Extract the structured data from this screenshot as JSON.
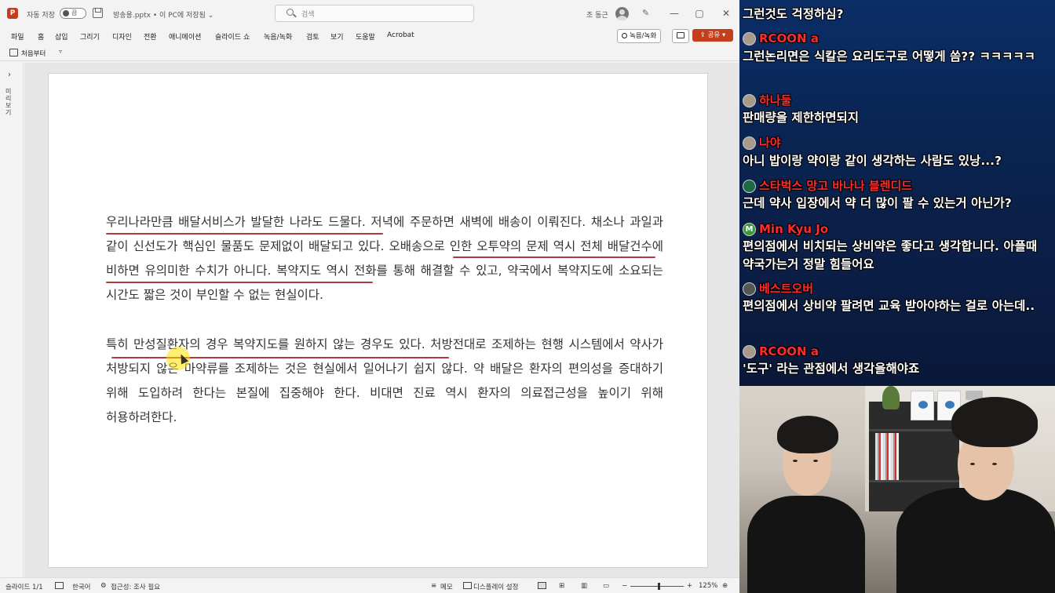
{
  "titlebar": {
    "logo_letter": "P",
    "autosave_label": "자동 저장",
    "autosave_state": "끔",
    "filename": "방송용.pptx • 이 PC에 저장됨 ⌄",
    "search_placeholder": "검색",
    "user_name": "조 동근",
    "minimize": "—",
    "maximize": "▢",
    "close": "✕"
  },
  "menu": {
    "items": [
      "파일",
      "홈",
      "삽입",
      "그리기",
      "디자인",
      "전환",
      "애니메이션",
      "슬라이드 쇼",
      "녹음/녹화",
      "검토",
      "보기",
      "도움말",
      "Acrobat"
    ],
    "record_button": "녹음/녹화",
    "share_button": "⇪ 공유 ▾"
  },
  "quickbar": {
    "label": "처음부터",
    "more": "▿"
  },
  "leftpane": {
    "chevron": "›",
    "label": "미리보기"
  },
  "slide": {
    "paragraph1": "우리나라만큼 배달서비스가 발달한 나라도 드물다. 저녁에 주문하면 새벽에 배송이 이뤄진다. 채소나 과일과 같이 신선도가 핵심인 물품도 문제없이 배달되고 있다. 오배송으로 인한 오투약의 문제 역시 전체 배달건수에 비하면 유의미한 수치가 아니다. 복약지도 역시 전화를 통해 해결할 수 있고, 약국에서 복약지도에 소요되는 시간도 짧은 것이 부인할 수 없는 현실이다.",
    "paragraph2": "특히 만성질환자의 경우 복약지도를 원하지 않는 경우도 있다. 처방전대로 조제하는 현행 시스템에서 약사가 처방되지 않은 마약류를 조제하는 것은 현실에서 일어나기 쉽지 않다. 약 배달은 환자의 편의성을 증대하기 위해 도입하려 한다는 본질에 집중해야 한다. 비대면 진료 역시 환자의 의료접근성을 높이기 위해 허용하려한다."
  },
  "statusbar": {
    "slide_counter": "슬라이드 1/1",
    "language": "한국어",
    "accessibility": "접근성: 조사 필요",
    "notes": "메모",
    "display_settings": "디스플레이 설정",
    "zoom_minus": "−",
    "zoom_plus": "+",
    "zoom_level": "125%"
  },
  "chat": {
    "messages": [
      {
        "name": "",
        "text": "그런것도 걱정하심?",
        "name_color": "#ff2a2a"
      },
      {
        "name": "RCOON a",
        "text": "그런논리면은 식칼은 요리도구로 어떻게 씀?? ㅋㅋㅋㅋㅋ",
        "name_color": "#ff2a2a"
      },
      {
        "name": "하나둘",
        "text": "판매량을 제한하면되지",
        "name_color": "#ff2a2a"
      },
      {
        "name": "나야",
        "text": "아니 밥이랑 약이랑 같이 생각하는 사람도 있낭...?",
        "name_color": "#ff2a2a"
      },
      {
        "name": "스타벅스 망고 바나나 블렌디드",
        "text": "근데 약사 입장에서 약 더 많이 팔 수 있는거 아닌가?",
        "name_color": "#ff2a2a"
      },
      {
        "name": "Min Kyu Jo",
        "text": "편의점에서 비치되는 상비약은 좋다고 생각합니다. 아플때 약국가는거 정말 힘들어요",
        "name_color": "#ff2a2a"
      },
      {
        "name": "베스트오버",
        "text": "편의점에서 상비약 팔려면 교육 받아야하는 걸로 아는데..",
        "name_color": "#ff2a2a"
      },
      {
        "name": "RCOON a",
        "text": "'도구' 라는 관점에서 생각을해야죠",
        "name_color": "#ff2a2a"
      }
    ]
  },
  "webcam": {
    "avatar_m_letter": "M",
    "frame_labels": [
      "",
      ""
    ]
  },
  "colors": {
    "accent": "#c43e1c",
    "underline": "#b23a3a",
    "chat_bg": "#0b2e66",
    "chat_name": "#ff2a2a"
  }
}
